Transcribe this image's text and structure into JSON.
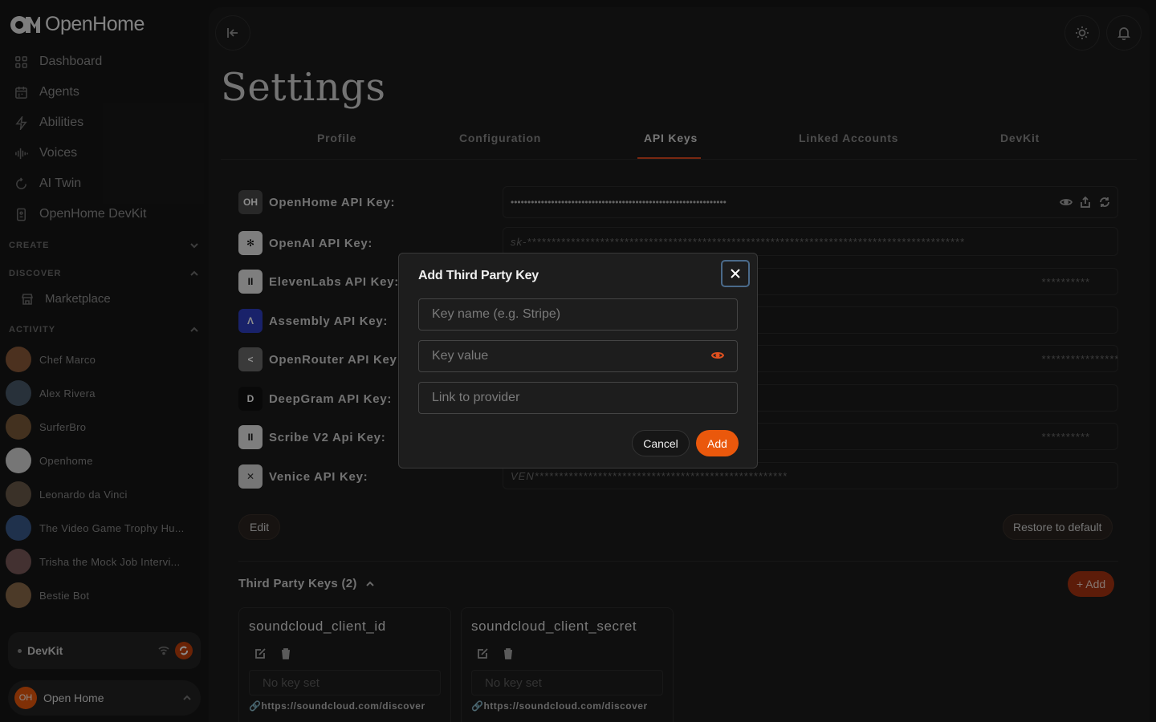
{
  "brand": {
    "name": "OpenHome"
  },
  "nav": [
    {
      "label": "Dashboard",
      "icon": "grid-icon"
    },
    {
      "label": "Agents",
      "icon": "calendar-icon"
    },
    {
      "label": "Abilities",
      "icon": "bolt-icon"
    },
    {
      "label": "Voices",
      "icon": "waveform-icon"
    },
    {
      "label": "AI Twin",
      "icon": "refresh-icon"
    },
    {
      "label": "OpenHome DevKit",
      "icon": "device-icon"
    }
  ],
  "sections": {
    "create": "CREATE",
    "discover": "DISCOVER",
    "activity": "ACTIVITY"
  },
  "discover_items": [
    {
      "label": "Marketplace",
      "icon": "store-icon"
    }
  ],
  "activity": [
    {
      "name": "Chef Marco",
      "color": "#8a5a3a"
    },
    {
      "name": "Alex Rivera",
      "color": "#4a5a6a"
    },
    {
      "name": "SurferBro",
      "color": "#7a5a3a"
    },
    {
      "name": "Openhome",
      "color": "#d8d8d8"
    },
    {
      "name": "Leonardo da Vinci",
      "color": "#6a5a4a"
    },
    {
      "name": "The Video Game Trophy Hu...",
      "color": "#3a5a8a"
    },
    {
      "name": "Trisha the Mock Job Intervi...",
      "color": "#7a5a5a"
    },
    {
      "name": "Bestie Bot",
      "color": "#8a6a4a"
    }
  ],
  "devkit": {
    "label": "DevKit"
  },
  "user": {
    "initials": "OH",
    "name": "Open Home"
  },
  "page": {
    "title": "Settings"
  },
  "tabs": [
    {
      "label": "Profile",
      "active": false
    },
    {
      "label": "Configuration",
      "active": false
    },
    {
      "label": "API Keys",
      "active": true
    },
    {
      "label": "Linked Accounts",
      "active": false
    },
    {
      "label": "DevKit",
      "active": false
    }
  ],
  "api_keys": [
    {
      "label": "OpenHome API Key:",
      "value": "••••••••••••••••••••••••••••••••••••••••••••••••••••••••••••••••"
    },
    {
      "label": "OpenAI API Key:",
      "value": "sk-******************************************************************************************"
    },
    {
      "label": "ElevenLabs API Key:",
      "value": "**********"
    },
    {
      "label": "Assembly API Key:",
      "value": ""
    },
    {
      "label": "OpenRouter API Key:",
      "value": "*********************************"
    },
    {
      "label": "DeepGram API Key:",
      "value": ""
    },
    {
      "label": "Scribe V2 Api Key:",
      "value": "**********"
    },
    {
      "label": "Venice API Key:",
      "value": "VEN****************************************************"
    }
  ],
  "actions": {
    "edit": "Edit",
    "restore": "Restore to default",
    "add": "+ Add"
  },
  "third_party": {
    "heading": "Third Party Keys (2)",
    "cards": [
      {
        "name": "soundcloud_client_id",
        "placeholder": "No key set",
        "link": "https://soundcloud.com/discover"
      },
      {
        "name": "soundcloud_client_secret",
        "placeholder": "No key set",
        "link": "https://soundcloud.com/discover"
      }
    ]
  },
  "modal": {
    "title": "Add Third Party Key",
    "key_name_placeholder": "Key name (e.g. Stripe)",
    "key_value_placeholder": "Key value",
    "link_placeholder": "Link to provider",
    "cancel": "Cancel",
    "add": "Add"
  },
  "colors": {
    "accent": "#ea580c",
    "background": "#171717",
    "panel": "#1c1c1c"
  }
}
